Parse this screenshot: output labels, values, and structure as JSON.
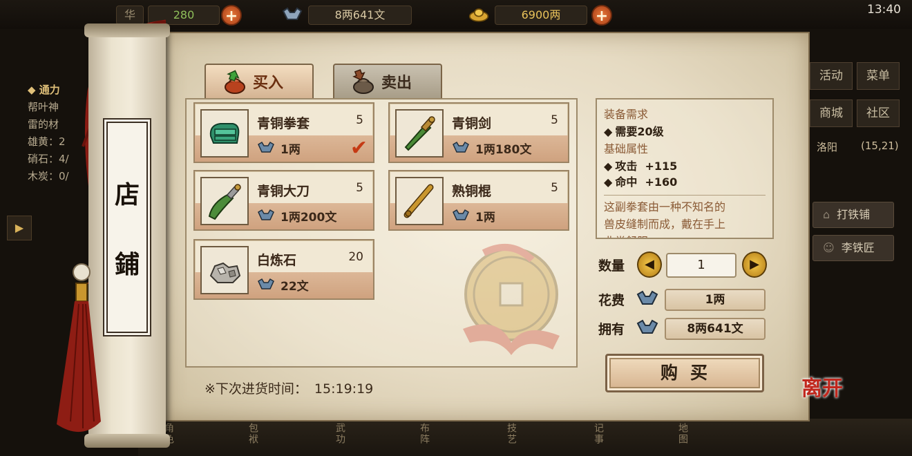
{
  "topbar": {
    "res1_label": "华",
    "res1_value": "280",
    "silver_value": "8两641文",
    "gold_value": "6900两",
    "time": "13:40"
  },
  "left_panel": {
    "title": "◆ 通力",
    "lines": [
      "帮叶神",
      "雷的材",
      "雄黄：2",
      "硝石：4/",
      "木炭：0/"
    ]
  },
  "right_menu": {
    "activity": "活动",
    "menu": "菜单",
    "shop": "商城",
    "community": "社区",
    "location": "洛阳",
    "coords": "(15,21)"
  },
  "npc_list": [
    "打铁铺",
    "李铁匠"
  ],
  "bottom_nav": [
    "角色",
    "包袱",
    "武功",
    "布阵",
    "技艺",
    "记事",
    "地图"
  ],
  "leave_label": "离开",
  "shop": {
    "title_char1": "店",
    "title_char2": "鋪",
    "tab_buy": "买入",
    "tab_sell": "卖出",
    "items": [
      {
        "name": "青铜拳套",
        "qty": "5",
        "price": "1两",
        "selected": true,
        "icon": "gauntlet-icon"
      },
      {
        "name": "青铜剑",
        "qty": "5",
        "price": "1两180文",
        "selected": false,
        "icon": "sword-icon"
      },
      {
        "name": "青铜大刀",
        "qty": "5",
        "price": "1两200文",
        "selected": false,
        "icon": "broadsword-icon"
      },
      {
        "name": "熟铜棍",
        "qty": "5",
        "price": "1两",
        "selected": false,
        "icon": "staff-icon"
      },
      {
        "name": "白炼石",
        "qty": "20",
        "price": "22文",
        "selected": false,
        "icon": "ore-icon"
      }
    ],
    "restock_label": "※下次进货时间：",
    "restock_time": "15:19:19"
  },
  "detail": {
    "req_title": "装备需求",
    "req_level": "需要20级",
    "attr_title": "基础属性",
    "attrs": [
      {
        "name": "攻击",
        "value": "+115"
      },
      {
        "name": "命中",
        "value": "+160"
      }
    ],
    "desc_line1": "这副拳套由一种不知名的",
    "desc_line2": "兽皮缝制而成，戴在手上",
    "desc_line3": "非常舒服"
  },
  "purchase": {
    "qty_label": "数量",
    "qty_value": "1",
    "cost_label": "花费",
    "cost_value": "1两",
    "own_label": "拥有",
    "own_value": "8两641文",
    "buy_label": "购买"
  },
  "colors": {
    "parchment": "#e6dbc3",
    "card_lower": "#cfa27f",
    "accent_red": "#c53a14",
    "gold_button": "#f4c94c"
  }
}
